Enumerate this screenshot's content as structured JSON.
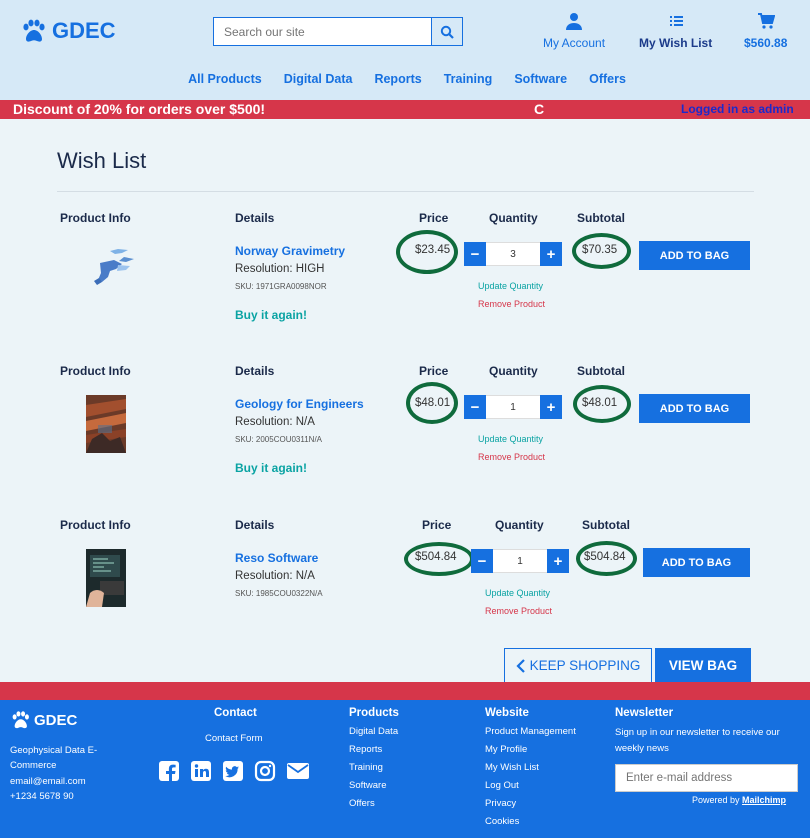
{
  "brand": {
    "name": "GDEC"
  },
  "header": {
    "search_placeholder": "Search our site",
    "my_account": "My Account",
    "my_wish_list": "My Wish List",
    "cart_total": "$560.88"
  },
  "nav": [
    "All Products",
    "Digital Data",
    "Reports",
    "Training",
    "Software",
    "Offers"
  ],
  "promo": {
    "message": "Discount of 20% for orders over $500!",
    "ticker_char": "C",
    "logged_in": "Logged in as admin"
  },
  "page": {
    "title": "Wish List"
  },
  "columns": {
    "product_info": "Product Info",
    "details": "Details",
    "price": "Price",
    "quantity": "Quantity",
    "subtotal": "Subtotal"
  },
  "items": [
    {
      "name": "Norway Gravimetry",
      "resolution": "Resolution: HIGH",
      "sku": "SKU: 1971GRA0098NOR",
      "buy_again": "Buy it again!",
      "price": "$23.45",
      "quantity": "3",
      "subtotal": "$70.35"
    },
    {
      "name": "Geology for Engineers",
      "resolution": "Resolution: N/A",
      "sku": "SKU: 2005COU0311N/A",
      "buy_again": "Buy it again!",
      "price": "$48.01",
      "quantity": "1",
      "subtotal": "$48.01"
    },
    {
      "name": "Reso Software",
      "resolution": "Resolution: N/A",
      "sku": "SKU: 1985COU0322N/A",
      "buy_again": "",
      "price": "$504.84",
      "quantity": "1",
      "subtotal": "$504.84"
    }
  ],
  "item_actions": {
    "update_quantity": "Update Quantity",
    "remove_product": "Remove Product",
    "add_to_bag": "ADD TO BAG",
    "minus": "−",
    "plus": "+"
  },
  "actions": {
    "keep_shopping": "KEEP SHOPPING",
    "view_bag": "VIEW BAG"
  },
  "footer": {
    "brand": "GDEC",
    "company_line1": "Geophysical Data E-",
    "company_line2": "Commerce",
    "email": "email@email.com",
    "phone": "+1234 5678 90",
    "contact_heading": "Contact",
    "contact_form": "Contact Form",
    "products_heading": "Products",
    "products": [
      "Digital Data",
      "Reports",
      "Training",
      "Software",
      "Offers"
    ],
    "website_heading": "Website",
    "website": [
      "Product Management",
      "My Profile",
      "My Wish List",
      "Log Out",
      "Privacy",
      "Cookies"
    ],
    "newsletter_heading": "Newsletter",
    "newsletter_line1": "Sign up in our newsletter to receive our",
    "newsletter_line2": "weekly news",
    "email_placeholder": "Enter e-mail address",
    "powered_by": "Powered by",
    "powered_brand": "Mailchimp"
  },
  "colors": {
    "primary": "#1670e0",
    "promo_red": "#d6364a",
    "header_bg": "#d6e9f7",
    "annotation_green": "#0f6b3c",
    "teal": "#0aa3a3"
  }
}
